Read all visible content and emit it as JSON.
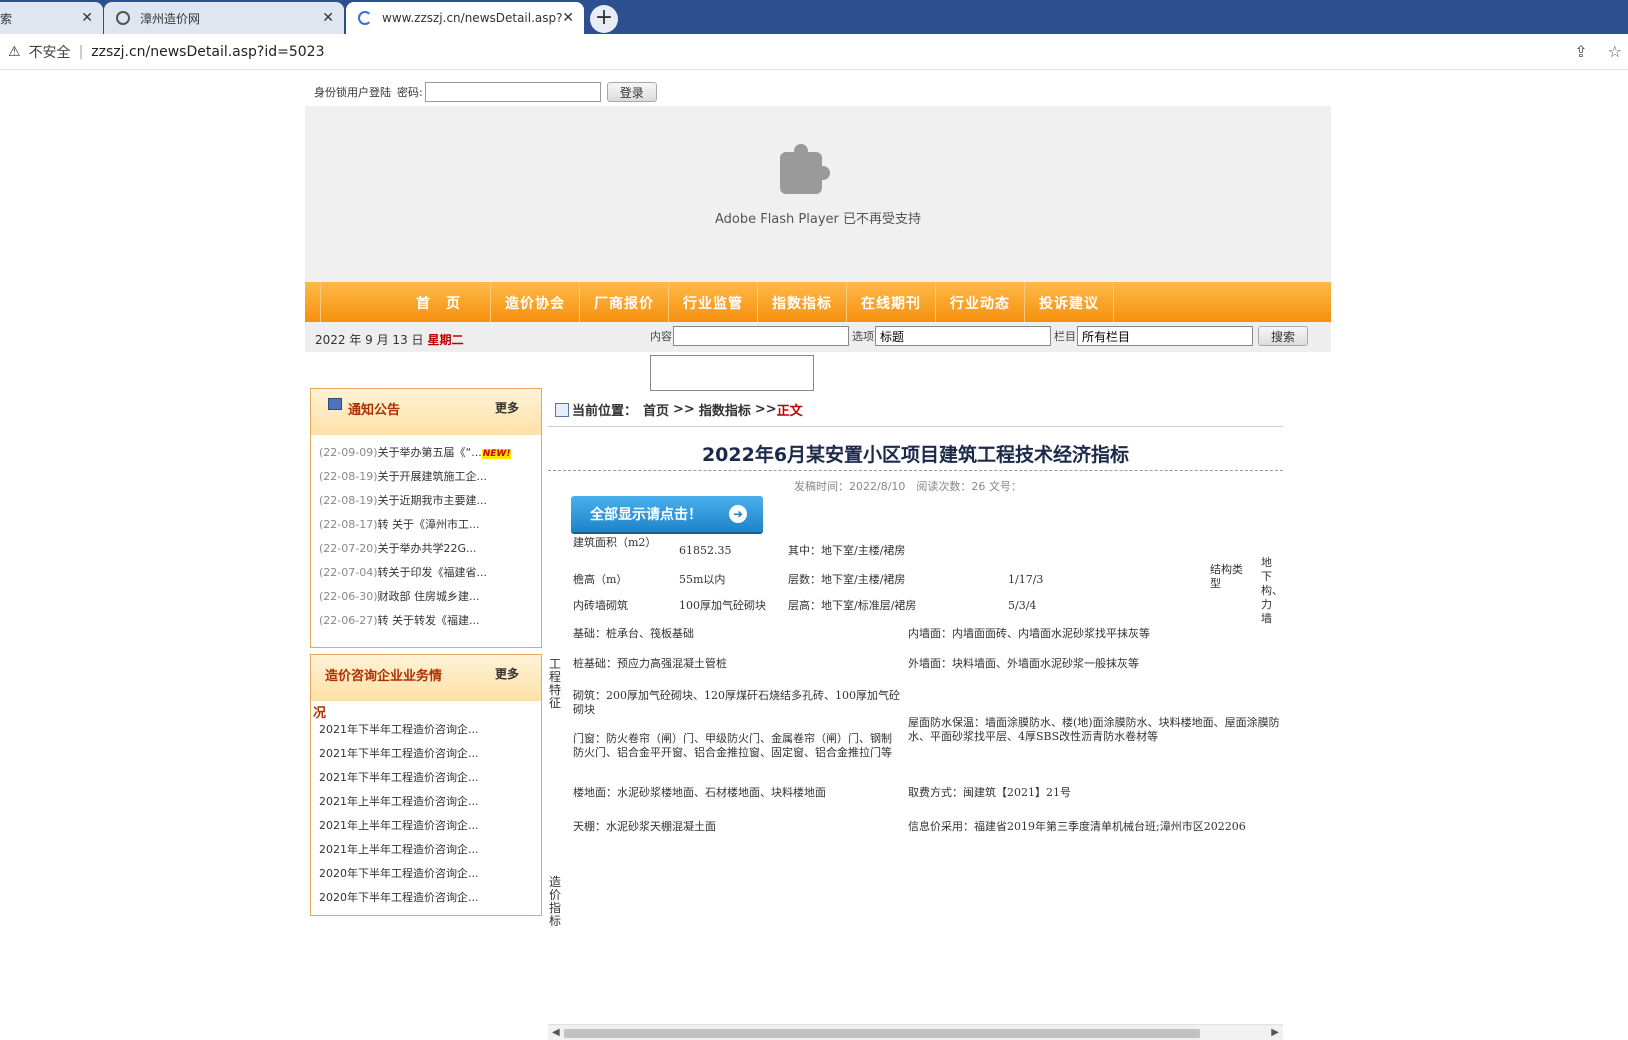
{
  "browser": {
    "tabs": [
      {
        "label": "索",
        "close": "✕"
      },
      {
        "label": "漳州造价网",
        "close": "✕"
      },
      {
        "label": "www.zzszj.cn/newsDetail.asp?i",
        "close": "✕"
      }
    ],
    "new_tab": "+",
    "security_label": "不安全",
    "url": "zzszj.cn/newsDetail.asp?id=5023"
  },
  "login": {
    "user_label": "身份锁用户登陆",
    "password_label": "密码:",
    "button": "登录"
  },
  "flash": {
    "message": "Adobe Flash Player 已不再受支持"
  },
  "nav": {
    "items": [
      "首页",
      "造价协会",
      "厂商报价",
      "行业监管",
      "指数指标",
      "在线期刊",
      "行业动态",
      "投诉建议"
    ]
  },
  "infobar": {
    "date": "2022 年 9 月 13 日",
    "weekday": "星期二",
    "content_label": "内容",
    "option_label": "选项",
    "option_value": "标题",
    "column_label": "栏目",
    "column_value": "所有栏目",
    "search_button": "搜索"
  },
  "notice": {
    "title": "通知公告",
    "more": "更多",
    "items": [
      {
        "date": "(22-09-09)",
        "text": "关于举办第五届《“...",
        "badge": "NEW!"
      },
      {
        "date": "(22-08-19)",
        "text": "关于开展建筑施工企..."
      },
      {
        "date": "(22-08-19)",
        "text": "关于近期我市主要建..."
      },
      {
        "date": "(22-08-17)",
        "text": "转 关于《漳州市工..."
      },
      {
        "date": "(22-07-20)",
        "text": "关于举办共学22G..."
      },
      {
        "date": "(22-07-04)",
        "text": "转关于印发《福建省..."
      },
      {
        "date": "(22-06-30)",
        "text": "财政部 住房城乡建..."
      },
      {
        "date": "(22-06-27)",
        "text": "转 关于转发《福建..."
      }
    ]
  },
  "company": {
    "title_line1": "造价咨询企业业务情",
    "title_line2": "况",
    "more": "更多",
    "items": [
      "2021年下半年工程造价咨询企...",
      "2021年下半年工程造价咨询企...",
      "2021年下半年工程造价咨询企...",
      "2021年上半年工程造价咨询企...",
      "2021年上半年工程造价咨询企...",
      "2021年上半年工程造价咨询企...",
      "2020年下半年工程造价咨询企...",
      "2020年下半年工程造价咨询企..."
    ]
  },
  "article": {
    "breadcrumb_prefix": "当前位置：",
    "breadcrumb_home": "首页",
    "breadcrumb_sep1": ">>",
    "breadcrumb_section": "指数指标",
    "breadcrumb_sep2": ">>",
    "breadcrumb_current": "正文",
    "title": "2022年6月某安置小区项目建筑工程技术经济指标",
    "meta": "发稿时间：2022/8/10　阅读次数：26 文号：",
    "show_all_button": "全部显示请点击！",
    "show_all_arrow": "➜"
  },
  "table": {
    "area_label": "建筑面积（m2）",
    "area_value": "61852.35",
    "area_note": "其中：地下室/主楼/裙房",
    "structure_label": "结构类型",
    "structure_value": "地下构、力墙",
    "eave_label": "檐高（m）",
    "eave_value": "55m以内",
    "floors_label": "层数：地下室/主楼/裙房",
    "floors_value": "1/17/3",
    "wall_label": "内砖墙砌筑",
    "wall_value": "100厚加气砼砌块",
    "height_label": "层高：地下室/标准层/裙房",
    "height_value": "5/3/4",
    "feature_vlabel": "工程特征",
    "foundation": "基础：桩承台、筏板基础",
    "inner_wall": "内墙面：内墙面面砖、内墙面水泥砂浆找平抹灰等",
    "pile": "桩基础：预应力高强混凝土管桩",
    "outer_wall": "外墙面：块料墙面、外墙面水泥砂浆一般抹灰等",
    "masonry": "砌筑：200厚加气砼砌块、120厚煤矸石烧结多孔砖、100厚加气砼砌块",
    "roof": "屋面防水保温：墙面涂膜防水、楼(地)面涂膜防水、块料楼地面、屋面涂膜防水、平面砂浆找平层、4厚SBS改性沥青防水卷材等",
    "doors": "门窗：防火卷帘（闸）门、甲级防火门、金属卷帘（闸）门、钢制防火门、铝合金平开窗、铝合金推拉窗、固定窗、铝合金推拉门等",
    "floor": "楼地面：水泥砂浆楼地面、石材楼地面、块料楼地面",
    "fee": "取费方式：闽建筑【2021】21号",
    "ceiling": "天棚：水泥砂浆天棚混凝土面",
    "price": "信息价采用：福建省2019年第三季度清单机械台班;漳州市区202206",
    "cost_vlabel": "造价指标"
  }
}
